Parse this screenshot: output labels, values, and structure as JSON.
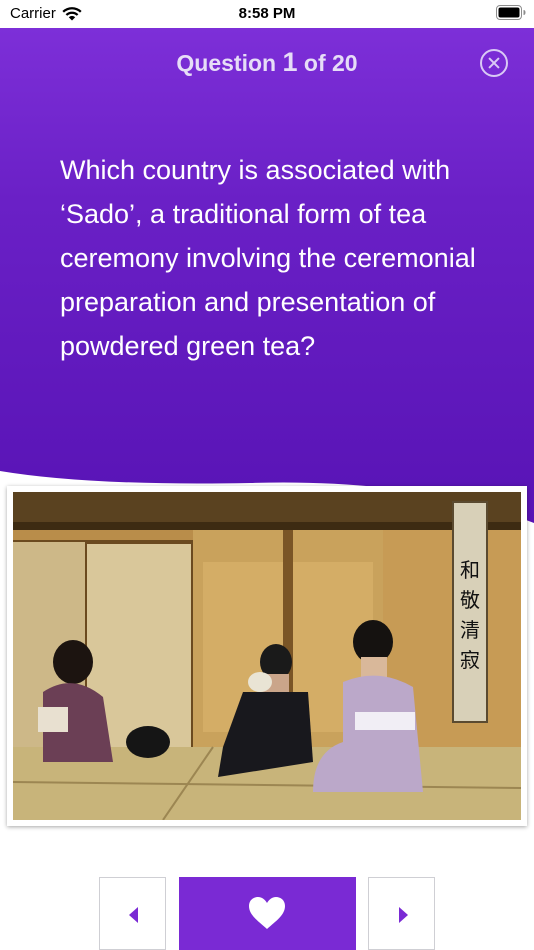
{
  "status_bar": {
    "carrier": "Carrier",
    "time": "8:58 PM"
  },
  "header": {
    "title_prefix": "Question",
    "question_number": "1",
    "title_suffix": "of 20"
  },
  "question": {
    "text": "Which country is associated with ‘Sado’, a traditional form of tea ceremony involving the ceremonial preparation and presentation of powdered green tea?"
  },
  "scroll_calligraphy": "和敬清寂",
  "icons": {
    "close": "close-circle-icon",
    "previous": "triangle-left-icon",
    "favorite": "heart-icon",
    "next": "triangle-right-icon"
  },
  "colors": {
    "accent": "#7a2ad4",
    "header_top": "#7d2fd8",
    "header_bottom": "#5b14b8"
  }
}
